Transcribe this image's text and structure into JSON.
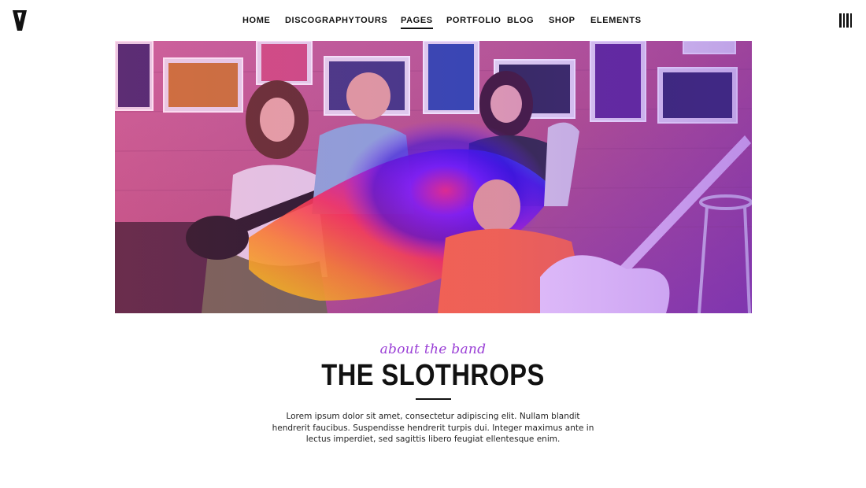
{
  "logo": {
    "glyph": "V"
  },
  "nav": {
    "items": [
      {
        "label": "HOME"
      },
      {
        "label": "DISCOGRAPHY"
      },
      {
        "label": "TOURS"
      },
      {
        "label": "PAGES",
        "active": true
      },
      {
        "label": "PORTFOLIO"
      },
      {
        "label": "BLOG"
      },
      {
        "label": "SHOP"
      },
      {
        "label": "ELEMENTS"
      }
    ]
  },
  "menu": {
    "icon": "hamburger-bars-icon"
  },
  "hero": {
    "image": "band-photo",
    "accent_colors": [
      "#ff2e9a",
      "#7a2cff",
      "#ff7a1a",
      "#f6e000",
      "#00c060"
    ]
  },
  "about": {
    "subtitle": "about the band",
    "title": "THE SLOTHROPS",
    "body": "Lorem ipsum dolor sit amet, consectetur adipiscing elit. Nullam blandit hendrerit faucibus. Suspendisse hendrerit turpis dui. Integer maximus ante in lectus imperdiet, sed sagittis libero feugiat ellentesque enim."
  },
  "colors": {
    "accent": "#9a3fd6",
    "text": "#111111",
    "background": "#ffffff"
  }
}
